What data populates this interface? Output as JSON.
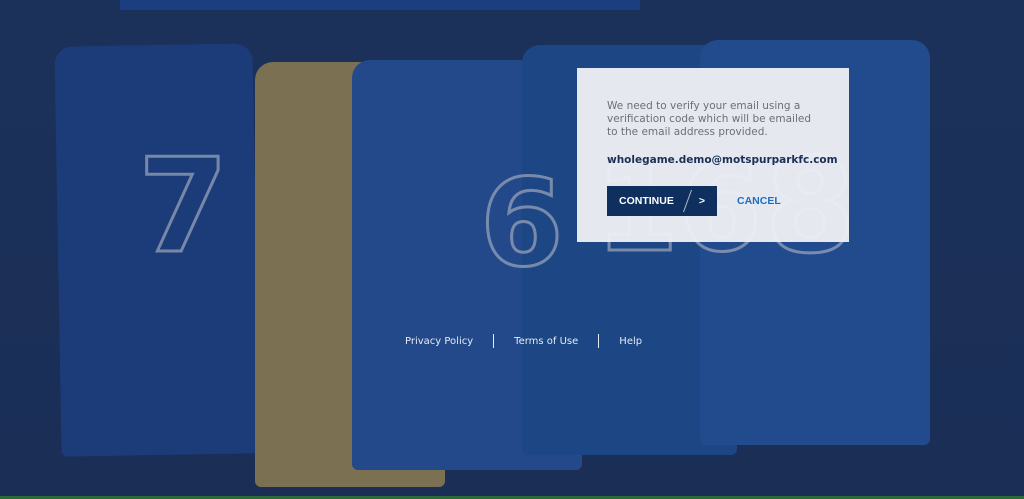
{
  "background": {
    "jersey_numbers": [
      "7",
      "6",
      "16",
      "8"
    ],
    "colors": {
      "blue": "#2b5fb0",
      "gold": "#b29b5a",
      "overlay": "#1f355e"
    }
  },
  "dialog": {
    "message": "We need to verify your email using a verification code which will be emailed to the email address provided.",
    "email": "wholegame.demo@motspurparkfc.com",
    "continue_label": "CONTINUE",
    "continue_arrow": ">",
    "cancel_label": "CANCEL"
  },
  "footer": {
    "links": [
      "Privacy Policy",
      "Terms of Use",
      "Help"
    ]
  }
}
